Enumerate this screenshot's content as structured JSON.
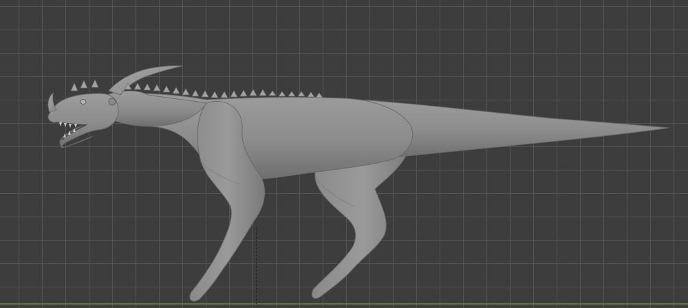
{
  "viewport": {
    "view": "orthographic-right",
    "shading": "solid",
    "background_color": "#3d3d3d",
    "grid_line_color": "#565656",
    "x_axis_color": "#5f7a3a"
  },
  "model": {
    "type": "dinosaur-sculpt",
    "base_color": "#8e8e8e",
    "shadow_color": "#6e6e6e",
    "highlight_color": "#a6a6a6"
  }
}
